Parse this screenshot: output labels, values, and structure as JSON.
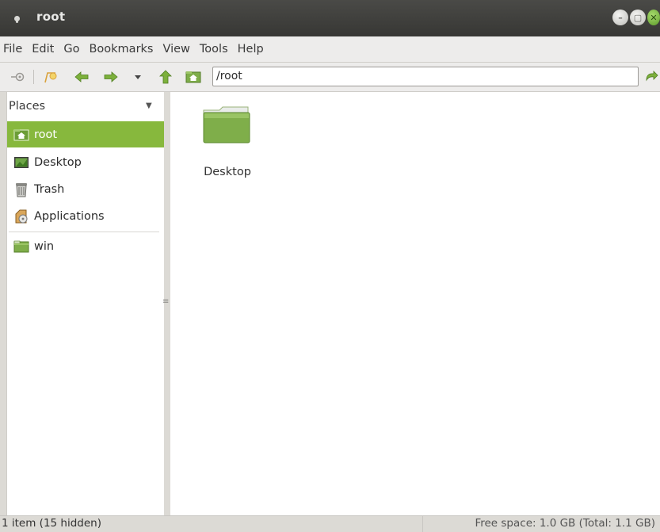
{
  "window": {
    "title": "root"
  },
  "menu": [
    "File",
    "Edit",
    "Go",
    "Bookmarks",
    "View",
    "Tools",
    "Help"
  ],
  "toolbar": {
    "location": "/root",
    "icons": [
      "key-icon",
      "new-tab-icon",
      "back-icon",
      "forward-icon",
      "history-dropdown-icon",
      "up-icon",
      "home-icon",
      "go-icon"
    ]
  },
  "sidebar": {
    "header": "Places",
    "items": [
      {
        "label": "root",
        "icon": "home-folder-icon",
        "active": true
      },
      {
        "label": "Desktop",
        "icon": "desktop-icon",
        "active": false
      },
      {
        "label": "Trash",
        "icon": "trash-icon",
        "active": false
      },
      {
        "label": "Applications",
        "icon": "applications-icon",
        "active": false
      }
    ],
    "bookmarks": [
      {
        "label": "win",
        "icon": "folder-icon"
      }
    ]
  },
  "files": [
    {
      "name": "Desktop",
      "icon": "folder-icon"
    }
  ],
  "status": {
    "left": "1 item (15 hidden)",
    "right": "Free space: 1.0 GB (Total: 1.1 GB)"
  },
  "colors": {
    "accent": "#87b83d",
    "titlebar": "#3c3c39",
    "folder": "#7fae4a"
  }
}
